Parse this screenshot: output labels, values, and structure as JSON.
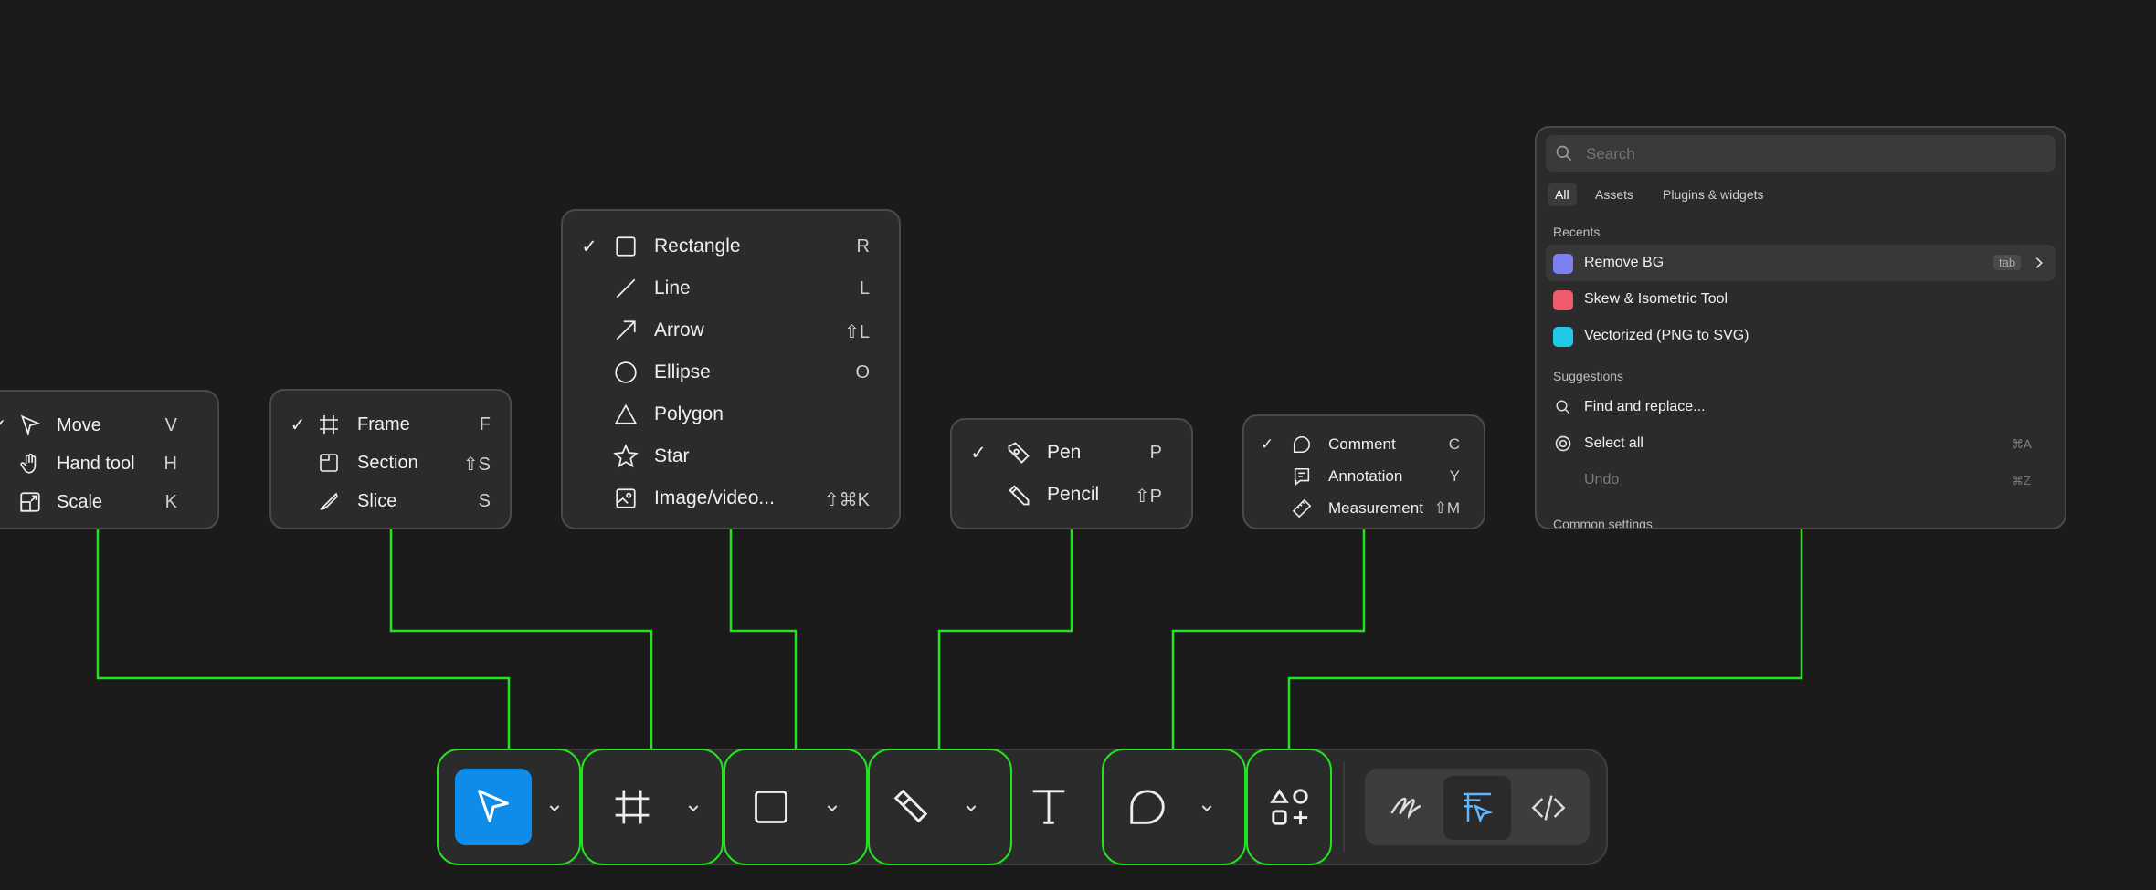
{
  "move_menu": {
    "items": [
      {
        "label": "Move",
        "shortcut": "V",
        "checked": true,
        "icon": "move-cursor-icon"
      },
      {
        "label": "Hand tool",
        "shortcut": "H",
        "checked": false,
        "icon": "hand-icon"
      },
      {
        "label": "Scale",
        "shortcut": "K",
        "checked": false,
        "icon": "scale-icon"
      }
    ]
  },
  "frame_menu": {
    "items": [
      {
        "label": "Frame",
        "shortcut": "F",
        "checked": true,
        "icon": "frame-icon"
      },
      {
        "label": "Section",
        "shortcut": "⇧S",
        "checked": false,
        "icon": "section-icon"
      },
      {
        "label": "Slice",
        "shortcut": "S",
        "checked": false,
        "icon": "slice-icon"
      }
    ]
  },
  "shape_menu": {
    "items": [
      {
        "label": "Rectangle",
        "shortcut": "R",
        "checked": true,
        "icon": "rectangle-icon"
      },
      {
        "label": "Line",
        "shortcut": "L",
        "checked": false,
        "icon": "line-icon"
      },
      {
        "label": "Arrow",
        "shortcut": "⇧L",
        "checked": false,
        "icon": "arrow-icon"
      },
      {
        "label": "Ellipse",
        "shortcut": "O",
        "checked": false,
        "icon": "ellipse-icon"
      },
      {
        "label": "Polygon",
        "shortcut": "",
        "checked": false,
        "icon": "polygon-icon"
      },
      {
        "label": "Star",
        "shortcut": "",
        "checked": false,
        "icon": "star-icon"
      },
      {
        "label": "Image/video...",
        "shortcut": "⇧⌘K",
        "checked": false,
        "icon": "image-icon"
      }
    ]
  },
  "pen_menu": {
    "items": [
      {
        "label": "Pen",
        "shortcut": "P",
        "checked": true,
        "icon": "pen-icon"
      },
      {
        "label": "Pencil",
        "shortcut": "⇧P",
        "checked": false,
        "icon": "pencil-icon"
      }
    ]
  },
  "comment_menu": {
    "items": [
      {
        "label": "Comment",
        "shortcut": "C",
        "checked": true,
        "icon": "comment-icon"
      },
      {
        "label": "Annotation",
        "shortcut": "Y",
        "checked": false,
        "icon": "annotation-icon"
      },
      {
        "label": "Measurement",
        "shortcut": "⇧M",
        "checked": false,
        "icon": "measurement-icon"
      }
    ]
  },
  "actions_panel": {
    "search_placeholder": "Search",
    "tabs": [
      "All",
      "Assets",
      "Plugins & widgets"
    ],
    "recents_title": "Recents",
    "recents": [
      {
        "label": "Remove BG",
        "badge": "tab",
        "color": "#7b7ff0"
      },
      {
        "label": "Skew & Isometric Tool",
        "color": "#ef5b6a"
      },
      {
        "label": "Vectorized (PNG to SVG)",
        "color": "#21c8e8"
      }
    ],
    "suggestions_title": "Suggestions",
    "suggestions": [
      {
        "label": "Find and replace...",
        "shortcut": "",
        "icon": "search-icon"
      },
      {
        "label": "Select all",
        "shortcut": "⌘A",
        "icon": "select-all-icon"
      },
      {
        "label": "Undo",
        "shortcut": "⌘Z",
        "icon": ""
      }
    ],
    "common_title": "Common settings"
  },
  "toolbar": {
    "move_tool": "move-cursor-icon",
    "frame_tool": "frame-icon",
    "shape_tool": "rectangle-icon",
    "pen_tool": "pen-icon",
    "text_tool": "text-icon",
    "comment_tool": "comment-icon",
    "actions_tool": "actions-icon",
    "modes": [
      "draw-icon",
      "design-icon",
      "dev-mode-icon"
    ]
  },
  "colors": {
    "accent": "#0d8ce9",
    "highlight": "#22e31e"
  }
}
